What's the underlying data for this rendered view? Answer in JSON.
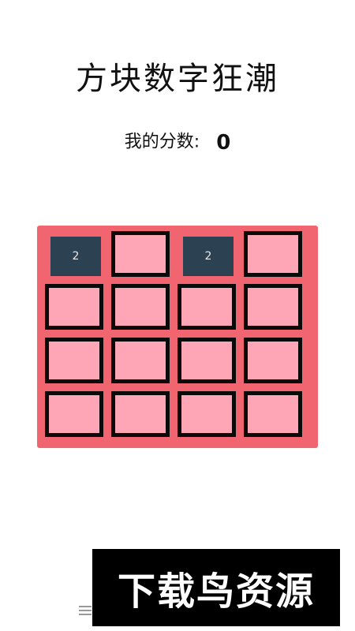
{
  "game": {
    "title": "方块数字狂潮",
    "score_label": "我的分数:",
    "score_value": "0"
  },
  "board": {
    "rows": 4,
    "cols": 4,
    "tiles": [
      [
        "2",
        "",
        "2",
        ""
      ],
      [
        "",
        "",
        "",
        ""
      ],
      [
        "",
        "",
        "",
        ""
      ],
      [
        "",
        "",
        "",
        ""
      ]
    ]
  },
  "colors": {
    "board_background": "#f0656f",
    "empty_cell": "#ffa6b6",
    "cell_border": "#0a0a0a",
    "tile_background": "#2c4252",
    "tile_text": "#e8e8e8"
  },
  "watermark": {
    "text": "下载鸟资源"
  },
  "nav": {
    "menu_icon": "menu-icon"
  }
}
